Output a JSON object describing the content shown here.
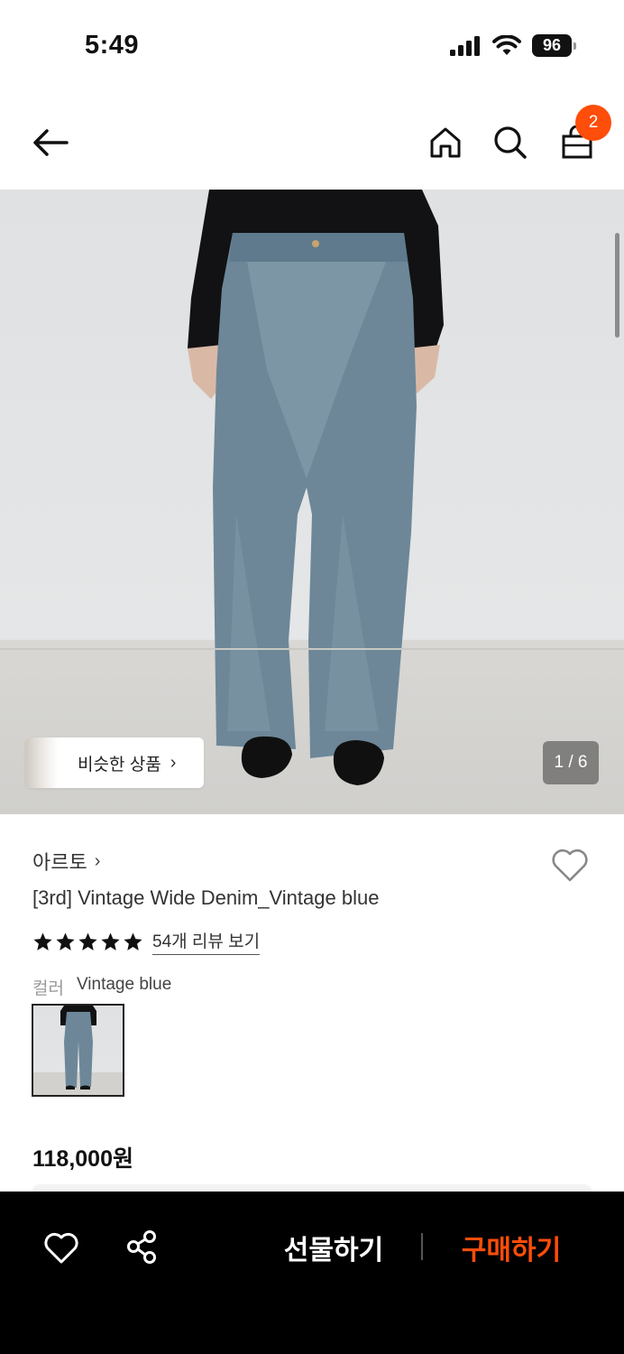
{
  "status_bar": {
    "time": "5:49",
    "battery": "96"
  },
  "header": {
    "back_icon": "arrow-left-icon",
    "home_icon": "home-icon",
    "search_icon": "search-icon",
    "bag_icon": "shopping-bag-icon",
    "cart_count": "2"
  },
  "gallery": {
    "similar_label": "비슷한 상품",
    "similar_chevron": "›",
    "page_indicator": "1 / 6"
  },
  "product": {
    "brand": "아르토",
    "brand_chevron": "›",
    "name": "[3rd] Vintage Wide Denim_Vintage blue",
    "rating_stars": 5,
    "review_link": "54개 리뷰 보기",
    "color_label": "컬러",
    "color_value": "Vintage blue",
    "price": "118,000원"
  },
  "bottom_bar": {
    "wish_icon": "heart-icon",
    "share_icon": "share-icon",
    "gift_label": "선물하기",
    "buy_label": "구매하기"
  },
  "colors": {
    "accent": "#ff4d0a",
    "bar_bg": "#000000"
  }
}
